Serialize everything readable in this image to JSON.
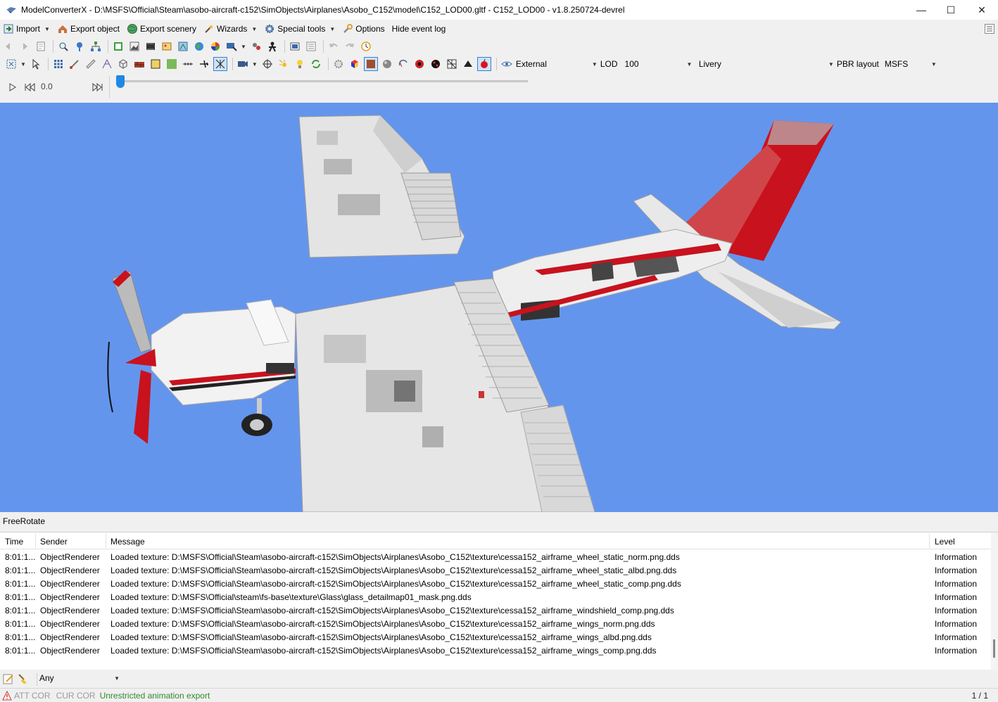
{
  "window": {
    "title": "ModelConverterX - D:\\MSFS\\Official\\Steam\\asobo-aircraft-c152\\SimObjects\\Airplanes\\Asobo_C152\\model\\C152_LOD00.gltf - C152_LOD00 - v1.8.250724-devrel",
    "minimize": "—",
    "maximize": "☐",
    "close": "✕"
  },
  "menu": {
    "import": "Import",
    "export_object": "Export object",
    "export_scenery": "Export scenery",
    "wizards": "Wizards",
    "special_tools": "Special tools",
    "options": "Options",
    "hide_event_log": "Hide event log"
  },
  "render_toolbar": {
    "view_label": "External",
    "lod_label": "LOD",
    "lod_value": "100",
    "livery_label": "Livery",
    "pbr_label": "PBR layout",
    "pbr_value": "MSFS"
  },
  "animation": {
    "time_value": "0.0"
  },
  "viewport": {
    "background": "#6495ed"
  },
  "mode": "FreeRotate",
  "log": {
    "columns": {
      "time": "Time",
      "sender": "Sender",
      "message": "Message",
      "level": "Level"
    },
    "rows": [
      {
        "time": "8:01:1...",
        "sender": "ObjectRenderer",
        "message": "Loaded texture: D:\\MSFS\\Official\\Steam\\asobo-aircraft-c152\\SimObjects\\Airplanes\\Asobo_C152\\texture\\cessa152_airframe_wheel_static_norm.png.dds",
        "level": "Information"
      },
      {
        "time": "8:01:1...",
        "sender": "ObjectRenderer",
        "message": "Loaded texture: D:\\MSFS\\Official\\Steam\\asobo-aircraft-c152\\SimObjects\\Airplanes\\Asobo_C152\\texture\\cessa152_airframe_wheel_static_albd.png.dds",
        "level": "Information"
      },
      {
        "time": "8:01:1...",
        "sender": "ObjectRenderer",
        "message": "Loaded texture: D:\\MSFS\\Official\\Steam\\asobo-aircraft-c152\\SimObjects\\Airplanes\\Asobo_C152\\texture\\cessa152_airframe_wheel_static_comp.png.dds",
        "level": "Information"
      },
      {
        "time": "8:01:1...",
        "sender": "ObjectRenderer",
        "message": "Loaded texture: D:\\MSFS\\Official\\steam\\fs-base\\texture\\Glass\\glass_detailmap01_mask.png.dds",
        "level": "Information"
      },
      {
        "time": "8:01:1...",
        "sender": "ObjectRenderer",
        "message": "Loaded texture: D:\\MSFS\\Official\\Steam\\asobo-aircraft-c152\\SimObjects\\Airplanes\\Asobo_C152\\texture\\cessa152_airframe_windshield_comp.png.dds",
        "level": "Information"
      },
      {
        "time": "8:01:1...",
        "sender": "ObjectRenderer",
        "message": "Loaded texture: D:\\MSFS\\Official\\Steam\\asobo-aircraft-c152\\SimObjects\\Airplanes\\Asobo_C152\\texture\\cessa152_airframe_wings_norm.png.dds",
        "level": "Information"
      },
      {
        "time": "8:01:1...",
        "sender": "ObjectRenderer",
        "message": "Loaded texture: D:\\MSFS\\Official\\Steam\\asobo-aircraft-c152\\SimObjects\\Airplanes\\Asobo_C152\\texture\\cessa152_airframe_wings_albd.png.dds",
        "level": "Information"
      },
      {
        "time": "8:01:1...",
        "sender": "ObjectRenderer",
        "message": "Loaded texture: D:\\MSFS\\Official\\Steam\\asobo-aircraft-c152\\SimObjects\\Airplanes\\Asobo_C152\\texture\\cessa152_airframe_wings_comp.png.dds",
        "level": "Information"
      }
    ]
  },
  "filter": {
    "value": "Any"
  },
  "status": {
    "att_cor": "ATT COR",
    "cur_cor": "CUR COR",
    "message": "Unrestricted animation export",
    "pager": "1 / 1"
  }
}
